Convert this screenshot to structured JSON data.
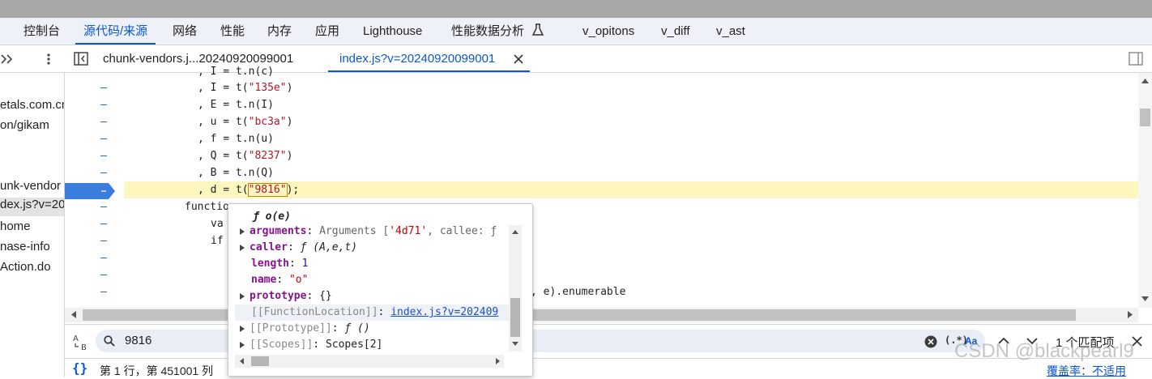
{
  "panel_tabs": [
    {
      "label": "控制台",
      "active": false
    },
    {
      "label": "源代码/来源",
      "active": true
    },
    {
      "label": "网络",
      "active": false
    },
    {
      "label": "性能",
      "active": false
    },
    {
      "label": "内存",
      "active": false
    },
    {
      "label": "应用",
      "active": false
    },
    {
      "label": "Lighthouse",
      "active": false
    },
    {
      "label": "性能数据分析",
      "active": false
    },
    {
      "label": "v_opitons",
      "active": false
    },
    {
      "label": "v_diff",
      "active": false
    },
    {
      "label": "v_ast",
      "active": false
    }
  ],
  "file_tabs": [
    {
      "label": "chunk-vendors.j...20240920099001",
      "active": false
    },
    {
      "label": "index.js?v=20240920099001",
      "active": true
    }
  ],
  "sidebar_items": [
    "etals.com.cn",
    "on/gikam",
    "unk-vendor",
    "dex.js?v=202",
    "home",
    "nase-info",
    "Action.do"
  ],
  "code_lines": [
    {
      "text": ", I = t.n(c)"
    },
    {
      "pre": ", I = t(",
      "str": "\"135e\"",
      "post": ")"
    },
    {
      "text": ", E = t.n(I)"
    },
    {
      "pre": ", u = t(",
      "str": "\"bc3a\"",
      "post": ")"
    },
    {
      "text": ", f = t.n(u)"
    },
    {
      "pre": ", Q = t(",
      "str": "\"8237\"",
      "post": ")"
    },
    {
      "text": ", B = t.n(Q)"
    },
    {
      "pre": ", d = t(",
      "str": "\"9816\"",
      "post": ");"
    },
    {
      "text": "functio"
    },
    {
      "text": "va"
    },
    {
      "text": "if"
    },
    {
      "text": ""
    },
    {
      "text": ""
    },
    {
      "text": ", e).enumerable"
    }
  ],
  "popup": {
    "title": "ƒ o(e)",
    "rows": [
      {
        "key": "arguments",
        "sep": ": ",
        "value": "Arguments [",
        "extra_str": "'4d71'",
        "extra": ", callee: ƒ"
      },
      {
        "key": "caller",
        "sep": ": ",
        "value": "ƒ (A,e,t)"
      },
      {
        "key": "length",
        "sep": ": ",
        "num": "1"
      },
      {
        "key": "name",
        "sep": ": ",
        "str": "\"o\""
      },
      {
        "key": "prototype",
        "sep": ": ",
        "value": "{}"
      },
      {
        "key": "[[FunctionLocation]]",
        "sep": ": ",
        "link": "index.js?v=202409"
      },
      {
        "key": "[[Prototype]]",
        "sep": ": ",
        "value": "ƒ ()"
      },
      {
        "key": "[[Scopes]]",
        "sep": ": ",
        "value": "Scopes[2]"
      }
    ]
  },
  "search": {
    "query": "9816",
    "regex_label": "(.*)",
    "case_label": "Aa",
    "match_count": "1 个匹配项"
  },
  "status": {
    "position": "第 1 行，第 451001 列",
    "coverage": "覆盖率：不适用"
  },
  "watermark": "CSDN @blackpearl9",
  "colors": {
    "accent": "#0b57d0",
    "highlight_row": "#fdf6bf",
    "breakpoint": "#3b7ddd"
  }
}
